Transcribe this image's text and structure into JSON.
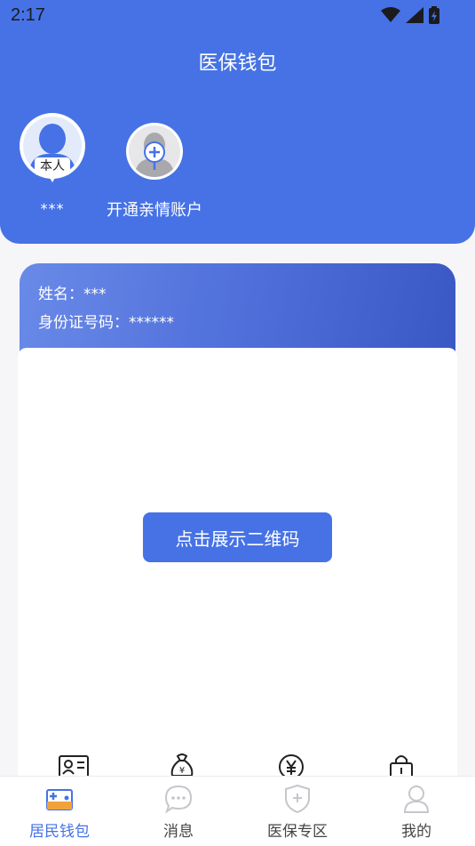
{
  "status_bar": {
    "time": "2:17"
  },
  "header": {
    "title": "医保钱包"
  },
  "accounts": [
    {
      "badge": "本人",
      "name": "***"
    },
    {
      "name": "开通亲情账户"
    }
  ],
  "card": {
    "name_label": "姓名：***",
    "id_label": "身份证号码：******"
  },
  "qr_button": "点击展示二维码",
  "tabs": [
    {
      "label": "居民钱包",
      "icon": "wallet-icon"
    },
    {
      "label": "消息",
      "icon": "message-icon"
    },
    {
      "label": "医保专区",
      "icon": "shield-plus-icon"
    },
    {
      "label": "我的",
      "icon": "user-icon"
    }
  ],
  "colors": {
    "primary": "#4672e6"
  }
}
